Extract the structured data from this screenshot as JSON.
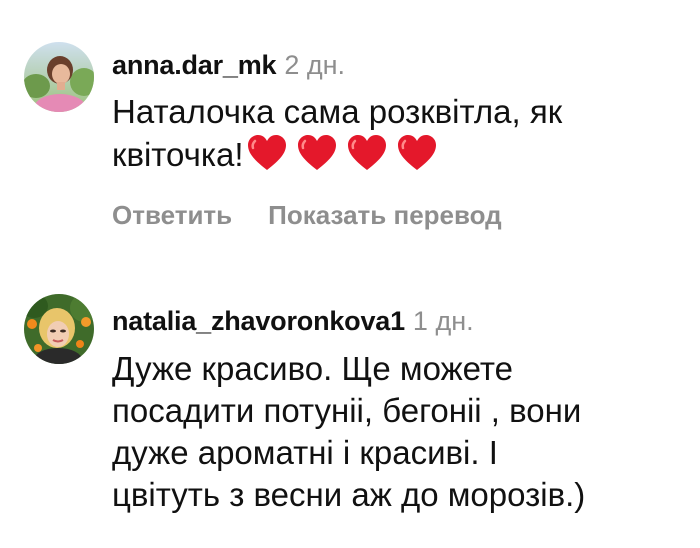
{
  "comments": [
    {
      "username": "anna.dar_mk",
      "time": "2 дн.",
      "text": "Наталочка сама розквітла, як квіточка!",
      "emoji_count": 4,
      "emoji": "heart-icon",
      "reply_label": "Ответить",
      "translate_label": "Показать перевод"
    },
    {
      "username": "natalia_zhavoronkova1",
      "time": "1 дн.",
      "text_lines": [
        "Дуже красиво. Ще можете",
        "посадити потуніі, бегоніі , вони",
        "дуже ароматні і красиві. І",
        "цвітуть з весни аж до морозів.)"
      ]
    }
  ],
  "colors": {
    "username": "#111111",
    "meta": "#8e8e8e",
    "heart": "#e4182b"
  }
}
